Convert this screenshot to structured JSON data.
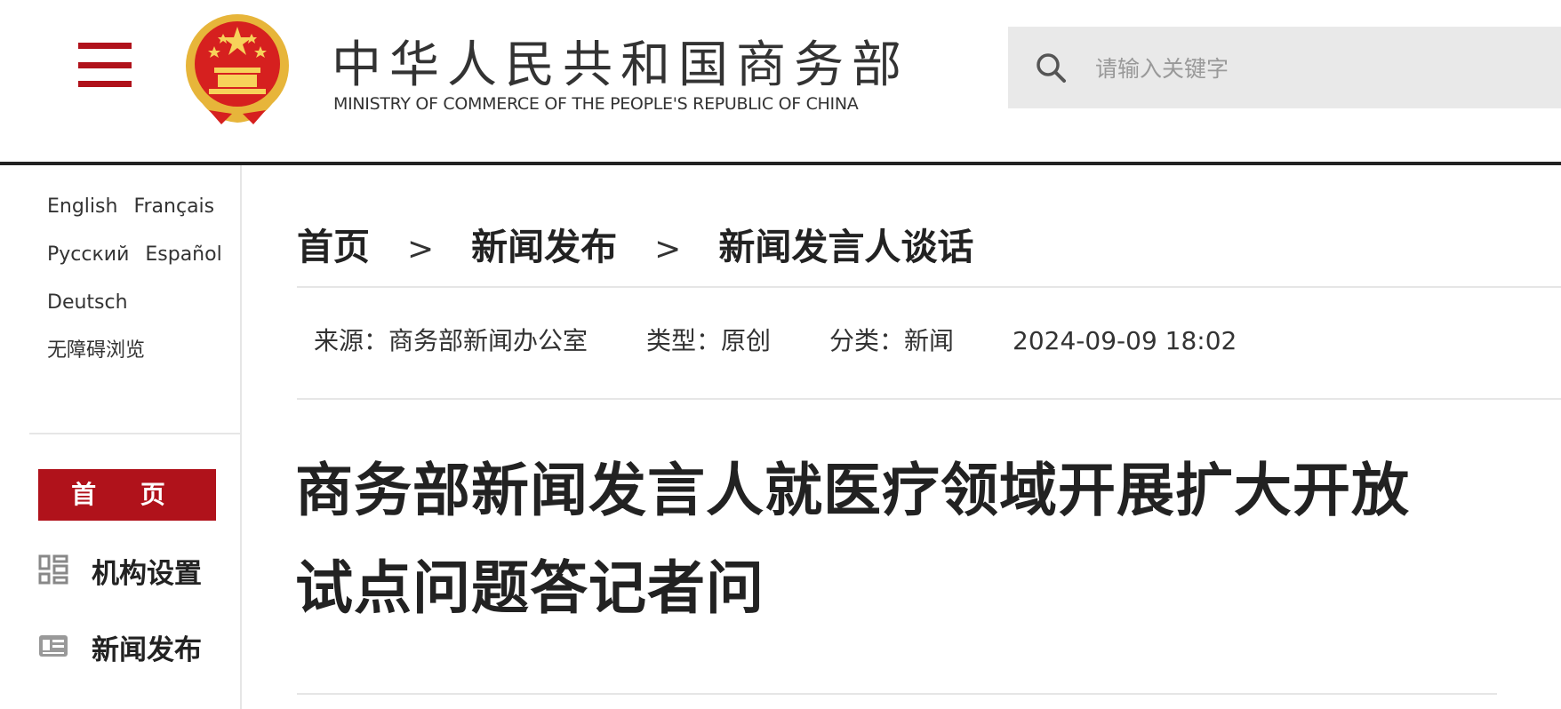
{
  "header": {
    "brand_cn": "中华人民共和国商务部",
    "brand_en": "MINISTRY OF COMMERCE OF THE PEOPLE'S REPUBLIC OF CHINA",
    "search_placeholder": "请输入关键字",
    "menu_icon": "hamburger-menu-icon",
    "search_icon": "search-icon",
    "emblem": "national-emblem",
    "accent_color": "#b0121b"
  },
  "sidebar": {
    "languages": [
      [
        "English",
        "Français"
      ],
      [
        "Русский",
        "Español"
      ],
      [
        "Deutsch"
      ],
      [
        "无障碍浏览"
      ]
    ],
    "home_label": "首 页",
    "nav": [
      {
        "label": "机构设置",
        "icon": "grid-icon"
      },
      {
        "label": "新闻发布",
        "icon": "newspaper-icon"
      }
    ]
  },
  "main": {
    "breadcrumb": [
      "首页",
      "新闻发布",
      "新闻发言人谈话"
    ],
    "breadcrumb_sep": ">",
    "meta": {
      "source": "来源：商务部新闻办公室",
      "type": "类型：原创",
      "category": "分类：新闻",
      "datetime": "2024-09-09 18:02"
    },
    "title": "商务部新闻发言人就医疗领域开展扩大开放试点问题答记者问"
  }
}
